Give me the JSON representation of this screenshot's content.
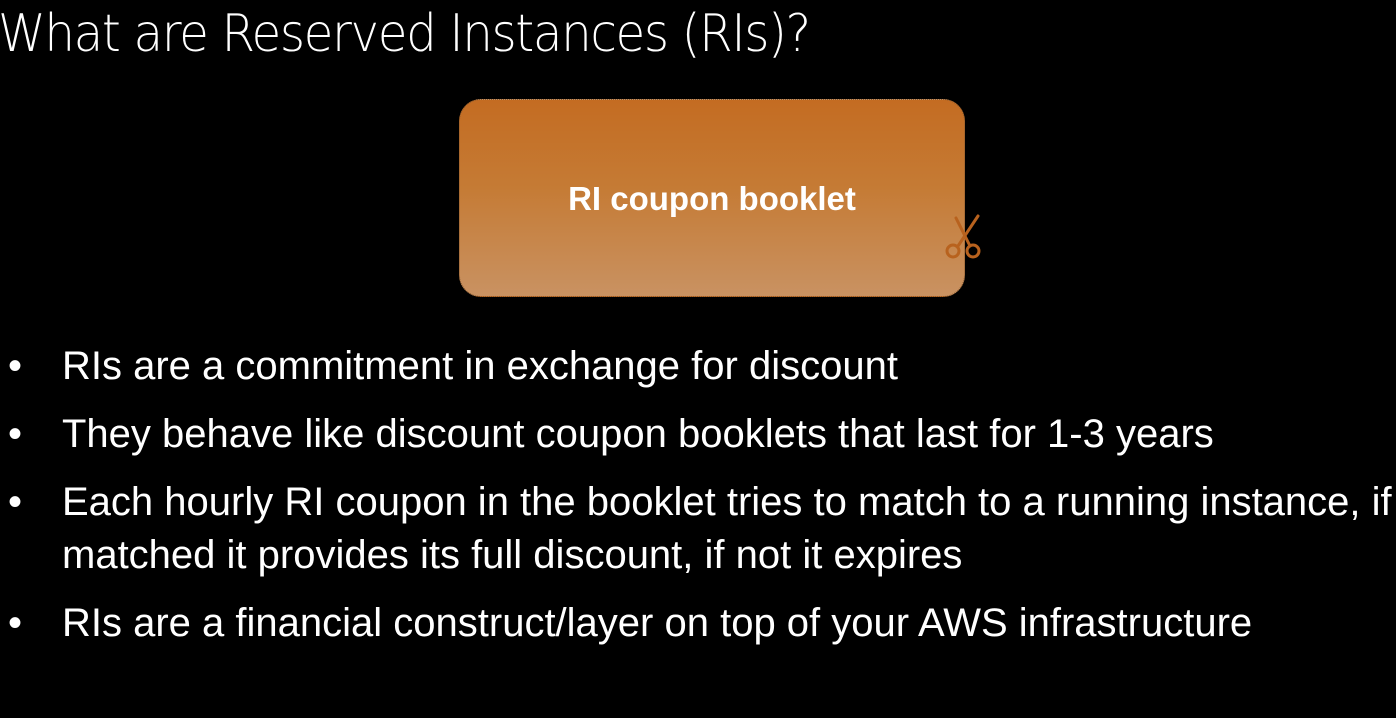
{
  "slide": {
    "title": "What are Reserved Instances (RIs)?",
    "coupon_label": "RI coupon booklet",
    "coupon_icon": "scissors-icon",
    "colors": {
      "coupon_top": "#c46c22",
      "coupon_bottom": "#c99262",
      "background": "#000000"
    },
    "bullet_symbol": "•",
    "bullets": [
      "RIs are a commitment in exchange for discount",
      "They behave like discount coupon booklets that last for 1-3 years",
      "Each hourly RI coupon in the booklet tries to match to a running instance, if matched it provides its full discount, if not it expires",
      "RIs are a financial construct/layer on top of your AWS infrastructure"
    ]
  }
}
